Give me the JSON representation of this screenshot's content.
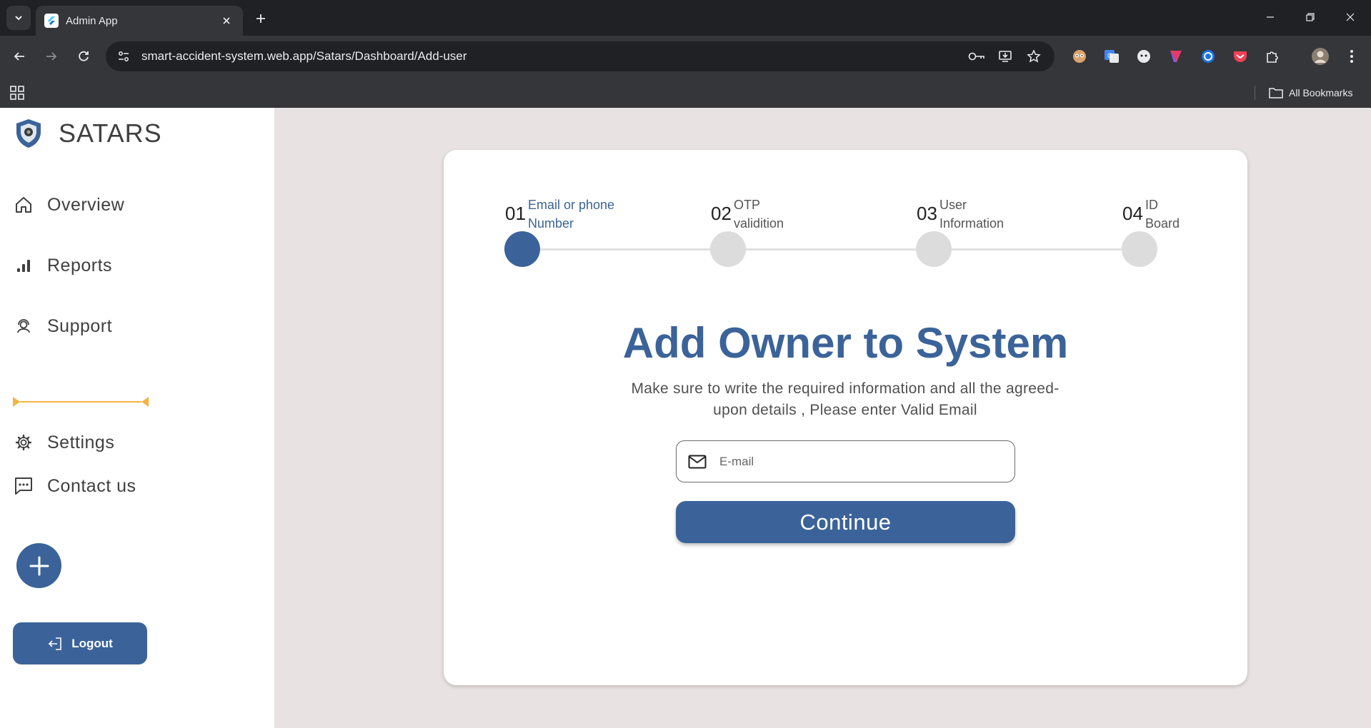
{
  "browser": {
    "tab_title": "Admin App",
    "url": "smart-accident-system.web.app/Satars/Dashboard/Add-user",
    "all_bookmarks": "All Bookmarks"
  },
  "sidebar": {
    "brand": "SATARS",
    "items": [
      {
        "label": "Overview",
        "icon": "home-icon"
      },
      {
        "label": "Reports",
        "icon": "bar-chart-icon"
      },
      {
        "label": "Support",
        "icon": "support-agent-icon"
      },
      {
        "label": "Settings",
        "icon": "gear-icon"
      },
      {
        "label": "Contact us",
        "icon": "chat-icon"
      }
    ],
    "logout_label": "Logout"
  },
  "stepper": {
    "active_step": 1,
    "steps": [
      {
        "num": "01",
        "label": "Email or phone Number"
      },
      {
        "num": "02",
        "label": "OTP validition"
      },
      {
        "num": "03",
        "label": "User Information"
      },
      {
        "num": "04",
        "label": "ID Board"
      }
    ]
  },
  "form": {
    "title": "Add Owner to System",
    "subtitle": "Make sure to write the required information and all the agreed-upon details , Please enter Valid Email",
    "email_placeholder": "E-mail",
    "continue_label": "Continue"
  },
  "colors": {
    "accent": "#3b6399",
    "divider": "#f5b342",
    "background": "#e8e2e2"
  }
}
